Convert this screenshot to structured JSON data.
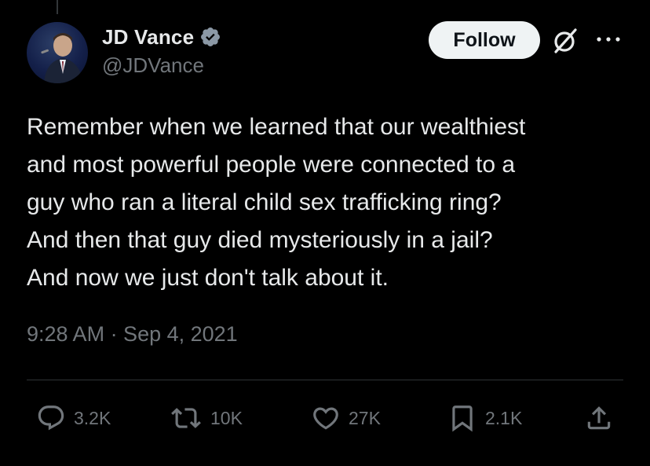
{
  "author": {
    "display_name": "JD Vance",
    "handle": "@JDVance",
    "verified": true,
    "avatar_icon": "profile-photo"
  },
  "header": {
    "follow_label": "Follow",
    "grok_icon": "grok-icon",
    "more_icon": "more-dots-icon"
  },
  "tweet": {
    "lines": [
      "Remember when we learned that our wealthiest",
      "and most powerful people were connected to a",
      "guy who ran a literal child sex trafficking ring?",
      "And then that guy died mysteriously in a jail?",
      "And now we just don't talk about it."
    ],
    "timestamp": "9:28 AM · Sep 4, 2021"
  },
  "actions": {
    "replies": "3.2K",
    "reposts": "10K",
    "likes": "27K",
    "bookmarks": "2.1K"
  },
  "colors": {
    "background": "#000000",
    "text_primary": "#e7e9ea",
    "text_secondary": "#71767b",
    "verified": "#8b98a5",
    "follow_bg": "#eff3f4",
    "divider": "#2f3336"
  }
}
